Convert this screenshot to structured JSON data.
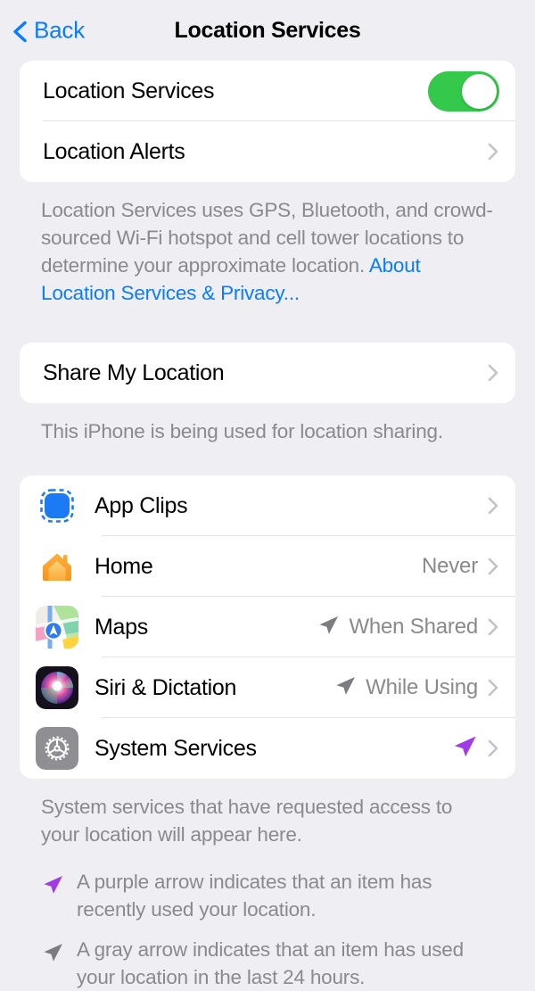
{
  "nav": {
    "back_label": "Back",
    "back_icon": "chevron-left-icon",
    "title": "Location Services"
  },
  "colors": {
    "accent_blue": "#0A7CFF",
    "toggle_green": "#34C94B",
    "purple_arrow": "#A13BE8",
    "gray_arrow": "#7B7B80",
    "page_background": "#EFEEF3",
    "card_background": "#FFFFFF",
    "secondary_text": "#8A8A8E"
  },
  "section_main": {
    "rows": [
      {
        "label": "Location Services",
        "control": "toggle",
        "toggle_on": true
      },
      {
        "label": "Location Alerts",
        "control": "chevron"
      }
    ],
    "footer": {
      "text": "Location Services uses GPS, Bluetooth, and crowd-sourced Wi-Fi hotspot and cell tower locations to determine your approximate location. ",
      "link": "About Location Services & Privacy..."
    }
  },
  "section_share": {
    "rows": [
      {
        "label": "Share My Location",
        "control": "chevron"
      }
    ],
    "footer": {
      "text": "This iPhone is being used for location sharing."
    }
  },
  "section_apps": {
    "rows": [
      {
        "label": "App Clips",
        "value": "",
        "arrow": "none",
        "icon": "app-clips-icon"
      },
      {
        "label": "Home",
        "value": "Never",
        "arrow": "none",
        "icon": "home-icon"
      },
      {
        "label": "Maps",
        "value": "When Shared",
        "arrow": "gray",
        "icon": "maps-icon"
      },
      {
        "label": "Siri & Dictation",
        "value": "While Using",
        "arrow": "gray",
        "icon": "siri-icon"
      },
      {
        "label": "System Services",
        "value": "",
        "arrow": "purple",
        "icon": "system-services-icon"
      }
    ],
    "footer": {
      "text": "System services that have requested access to your location will appear here."
    }
  },
  "legend": {
    "items": [
      {
        "arrow": "purple",
        "text": "A purple arrow indicates that an item has recently used your location."
      },
      {
        "arrow": "gray",
        "text": "A gray arrow indicates that an item has used your location in the last 24 hours."
      }
    ]
  }
}
